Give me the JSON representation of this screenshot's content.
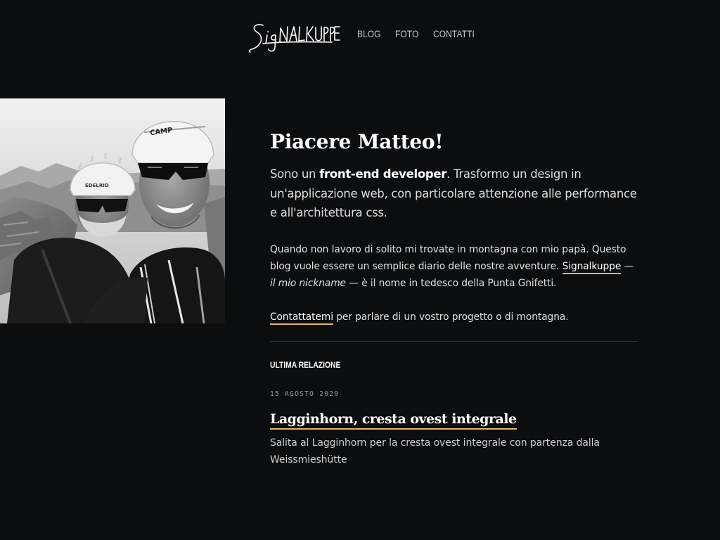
{
  "header": {
    "logo_text": "Signalkuppe",
    "nav": [
      {
        "label": "BLOG"
      },
      {
        "label": "FOTO"
      },
      {
        "label": "CONTATTI"
      }
    ]
  },
  "intro": {
    "title": "Piacere Matteo!",
    "lead_before": "Sono un ",
    "lead_strong": "front-end developer",
    "lead_after": ". Trasformo un design in un'applicazione web, con particolare attenzione alle performance e all'architettura css.",
    "para1_before": "Quando non lavoro di solito mi trovate in montagna con mio papà. Questo blog vuole essere un semplice diario delle nostre avventure. ",
    "para1_link": "Signalkuppe",
    "para1_dash1": " — ",
    "para1_em": "il mio nickname",
    "para1_after": " — è il nome in tedesco della Punta Gnifetti.",
    "para2_link": "Contattatemi",
    "para2_after": " per parlare di un vostro progetto o di montagna."
  },
  "latest": {
    "section_label": "ULTIMA RELAZIONE",
    "date": "15 AGOSTO 2020",
    "title": "Lagginhorn, cresta ovest integrale",
    "excerpt": "Salita al Lagginhorn per la cresta ovest integrale con partenza dalla Weissmieshütte"
  },
  "photo": {
    "helmet_left_brand": "EDELRID",
    "helmet_right_brand": "CAMP"
  },
  "colors": {
    "background": "#0c0d0f",
    "accent_underline": "#e2b659",
    "text": "#e6e6e6"
  }
}
